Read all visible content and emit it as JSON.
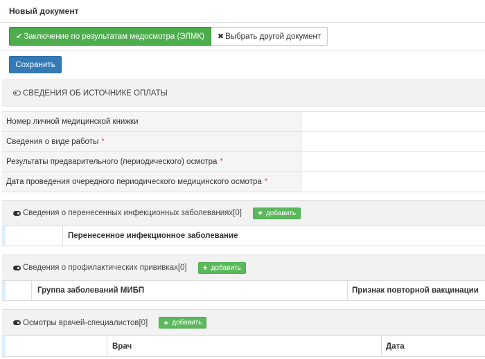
{
  "header": {
    "title": "Новый документ"
  },
  "doc_buttons": {
    "active_label": "Заключение по результатам медосмотра (ЭЛМК)",
    "other_label": "Выбрать другой документ"
  },
  "save_label": "Сохранить",
  "payment_section": {
    "title": "СВЕДЕНИЯ ОБ ИСТОЧНИКЕ ОПЛАТЫ"
  },
  "form": {
    "rows": [
      {
        "label": "Номер личной медицинской книжки",
        "required": ""
      },
      {
        "label": "Сведения о виде работы",
        "required": "*"
      },
      {
        "label": "Результаты предварительного (периодического) осмотра",
        "required": "*"
      },
      {
        "label": "Дата проведения очередного периодического медицинского осмотра",
        "required": "*"
      }
    ]
  },
  "infections": {
    "title": "Сведения о перенесенных инфекционных заболеваниях[0]",
    "add_label": "добавить",
    "columns": [
      "Перенесенное инфекционное заболевание"
    ]
  },
  "vaccinations": {
    "title": "Сведения о профилактических прививках[0]",
    "add_label": "добавить",
    "columns": [
      "Группа заболеваний МИБП",
      "Признак повторной вакцинации"
    ]
  },
  "exams": {
    "title": "Осмотры врачей-специалистов[0]",
    "add_label": "добавить",
    "columns": [
      "Врач",
      "Дата"
    ]
  }
}
